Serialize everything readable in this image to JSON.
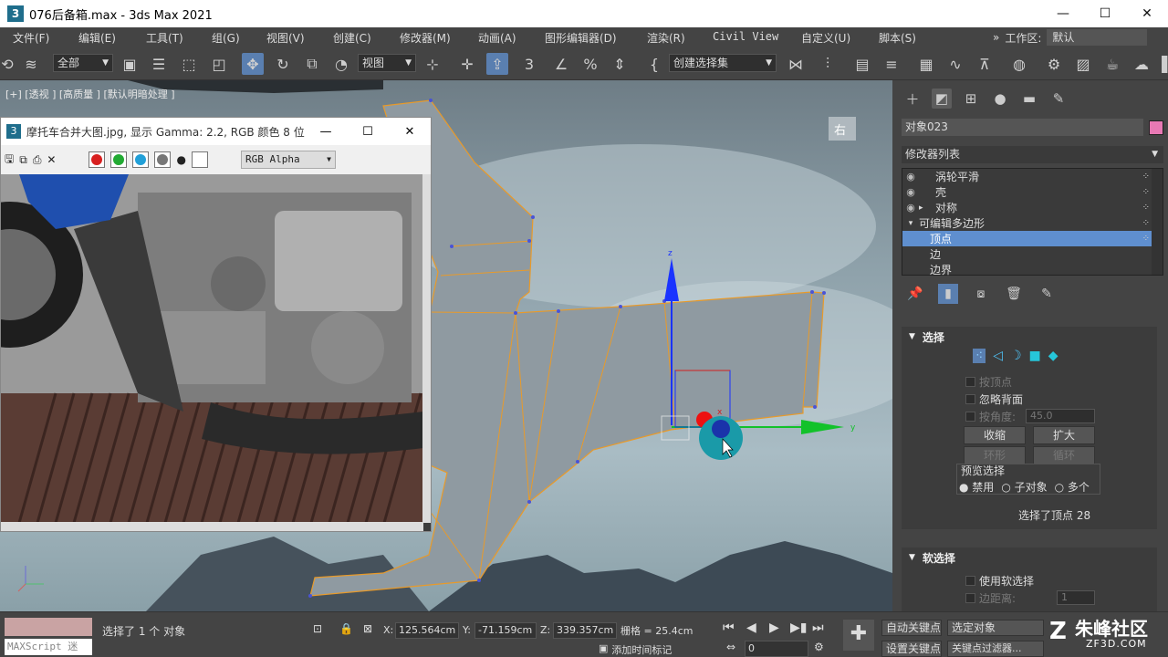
{
  "window": {
    "title": "076后备箱.max - 3ds Max 2021",
    "app_icon": "3",
    "minimize": "—",
    "maximize": "☐",
    "close": "✕"
  },
  "menu": {
    "items": [
      "文件(F)",
      "编辑(E)",
      "工具(T)",
      "组(G)",
      "视图(V)",
      "创建(C)",
      "修改器(M)",
      "动画(A)",
      "图形编辑器(D)",
      "渲染(R)",
      "Civil View",
      "自定义(U)",
      "脚本(S)"
    ],
    "more": "»",
    "workspace_label": "工作区:",
    "workspace_value": "默认"
  },
  "toolbar": {
    "filter": "全部",
    "ref_coord": "视图",
    "named_sel": "创建选择集"
  },
  "viewport": {
    "label": "[+] [透视 ] [高质量 ] [默认明暗处理 ]",
    "viewcube": "右",
    "axis_x": "x",
    "axis_y": "y",
    "axis_z": "z"
  },
  "image_window": {
    "title": "摩托车合并大图.jpg, 显示 Gamma: 2.2, RGB 颜色 8 位...",
    "channel": "RGB Alpha",
    "colors": {
      "red": "#d82020",
      "green": "#22aa33",
      "blue": "#22a0d8"
    }
  },
  "panel": {
    "object_name": "对象023",
    "object_color": "#e879b4",
    "modifier_list": "修改器列表",
    "stack": [
      {
        "label": "涡轮平滑",
        "eye": "👁",
        "indent": 0
      },
      {
        "label": "壳",
        "eye": "👁",
        "indent": 0
      },
      {
        "label": "对称",
        "eye": "👁",
        "indent": 0,
        "expand": "▸"
      },
      {
        "label": "可编辑多边形",
        "eye": "",
        "indent": 0,
        "expand": "▾"
      },
      {
        "label": "顶点",
        "eye": "",
        "indent": 1,
        "selected": true
      },
      {
        "label": "边",
        "eye": "",
        "indent": 1
      },
      {
        "label": "边界",
        "eye": "",
        "indent": 1
      }
    ],
    "selection": {
      "header": "选择",
      "by_vertex": "按顶点",
      "ignore_backfacing": "忽略背面",
      "by_angle": "按角度:",
      "angle_value": "45.0",
      "shrink": "收缩",
      "grow": "扩大",
      "ring": "环形",
      "loop": "循环",
      "preview_header": "预览选择",
      "preview_disabled": "禁用",
      "preview_subobject": "子对象",
      "preview_multi": "多个",
      "status": "选择了顶点 28"
    },
    "soft_selection": {
      "header": "软选择",
      "use_soft": "使用软选择",
      "edge_distance": "边距离:",
      "edge_value": "1"
    }
  },
  "status": {
    "maxscript": "MAXScript 迷",
    "selected": "选择了 1 个 对象",
    "x_label": "X:",
    "x": "125.564cm",
    "y_label": "Y:",
    "y": "-71.159cm",
    "z_label": "Z:",
    "z": "339.357cm",
    "grid": "栅格 = 25.4cm",
    "add_time_tag": "添加时间标记",
    "frame": "0",
    "auto_key": "自动关键点",
    "set_key": "设置关键点",
    "selected_object": "选定对象",
    "key_filters": "关键点过滤器..."
  },
  "watermark": {
    "brand": "朱峰社区",
    "url": "ZF3D.COM"
  }
}
